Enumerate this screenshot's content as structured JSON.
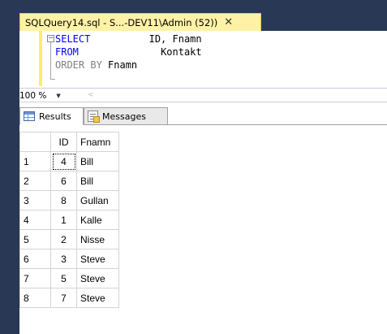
{
  "tab": {
    "title": "SQLQuery14.sql - S...-DEV11\\Admin (52))",
    "close_glyph": "✕"
  },
  "editor": {
    "collapse_glyph": "−",
    "lines": [
      {
        "keyword": "SELECT",
        "spacing": "          ",
        "rest": "ID, Fnamn"
      },
      {
        "keyword": "FROM",
        "spacing": "              ",
        "rest": "Kontakt"
      },
      {
        "keyword": "ORDER BY",
        "spacing": " ",
        "rest": "Fnamn"
      }
    ]
  },
  "zoom": {
    "value": "100 %",
    "arrow": "▼",
    "scroll_left": "<"
  },
  "results": {
    "tabs": [
      {
        "label": "Results",
        "icon": "grid-icon",
        "active": true
      },
      {
        "label": "Messages",
        "icon": "messages-icon",
        "active": false
      }
    ],
    "columns": [
      "ID",
      "Fnamn"
    ],
    "rows": [
      {
        "num": "1",
        "id": "4",
        "name": "Bill"
      },
      {
        "num": "2",
        "id": "6",
        "name": "Bill"
      },
      {
        "num": "3",
        "id": "8",
        "name": "Gullan"
      },
      {
        "num": "4",
        "id": "1",
        "name": "Kalle"
      },
      {
        "num": "5",
        "id": "2",
        "name": "Nisse"
      },
      {
        "num": "6",
        "id": "3",
        "name": "Steve"
      },
      {
        "num": "7",
        "id": "5",
        "name": "Steve"
      },
      {
        "num": "8",
        "id": "7",
        "name": "Steve"
      }
    ]
  },
  "colors": {
    "chrome": "#293955",
    "active_tab": "#fff2a6",
    "keyword": "#0000ff",
    "keyword_gray": "#808080"
  }
}
